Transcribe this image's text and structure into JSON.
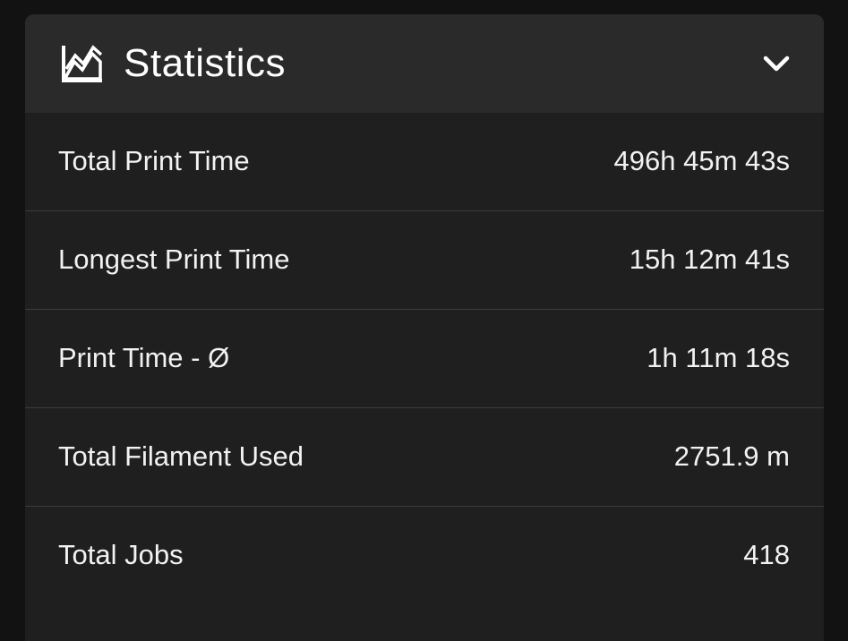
{
  "header": {
    "icon": "line-chart-icon",
    "title": "Statistics",
    "toggle_icon": "chevron-down-icon"
  },
  "rows": [
    {
      "label": "Total Print Time",
      "value": "496h 45m 43s"
    },
    {
      "label": "Longest Print Time",
      "value": "15h 12m 41s"
    },
    {
      "label": "Print Time - Ø",
      "value": "1h 11m 18s"
    },
    {
      "label": "Total Filament Used",
      "value": "2751.9 m"
    },
    {
      "label": "Total Jobs",
      "value": "418"
    }
  ]
}
